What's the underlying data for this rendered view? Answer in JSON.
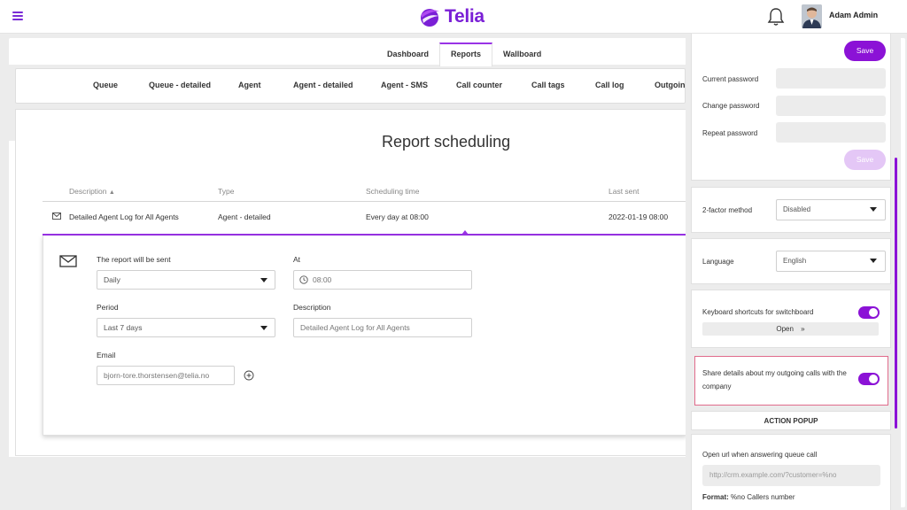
{
  "header": {
    "logo_text": "Telia",
    "user_name": "Adam Admin"
  },
  "tabs": [
    {
      "label": "Dashboard",
      "active": false
    },
    {
      "label": "Reports",
      "active": true
    },
    {
      "label": "Wallboard",
      "active": false
    }
  ],
  "subnav": [
    "Queue",
    "Queue - detailed",
    "Agent",
    "Agent - detailed",
    "Agent - SMS",
    "Call counter",
    "Call tags",
    "Call log",
    "Outgoing"
  ],
  "page_title": "Report scheduling",
  "table": {
    "columns": [
      "Description",
      "Type",
      "Scheduling time",
      "Last sent"
    ],
    "sort_indicator": "▲",
    "row": {
      "description": "Detailed Agent Log for All Agents",
      "type": "Agent - detailed",
      "scheduling_time": "Every day at 08:00",
      "last_sent": "2022-01-19 08:00"
    }
  },
  "detail": {
    "sent_label": "The report will be sent",
    "sent_value": "Daily",
    "at_label": "At",
    "at_value": "08:00",
    "period_label": "Period",
    "period_value": "Last 7 days",
    "description_label": "Description",
    "description_value": "Detailed Agent Log for All Agents",
    "email_label": "Email",
    "email_value": "bjorn-tore.thorstensen@telia.no"
  },
  "panel": {
    "save_label": "Save",
    "current_password_label": "Current password",
    "change_password_label": "Change password",
    "repeat_password_label": "Repeat password",
    "save2_label": "Save",
    "two_factor_label": "2-factor method",
    "two_factor_value": "Disabled",
    "language_label": "Language",
    "language_value": "English",
    "keyboard_label": "Keyboard shortcuts for switchboard",
    "open_label": "Open",
    "share_label": "Share details about my outgoing calls with the company",
    "action_popup_label": "ACTION POPUP",
    "open_url_label": "Open url when answering queue call",
    "open_url_placeholder": "http://crm.example.com/?customer=%no",
    "format_label": "Format:",
    "format_value": "%no Callers number"
  },
  "colors": {
    "accent": "#8b12d6",
    "accent_light": "#e4c7f6",
    "highlight_border": "#e06b8b"
  }
}
